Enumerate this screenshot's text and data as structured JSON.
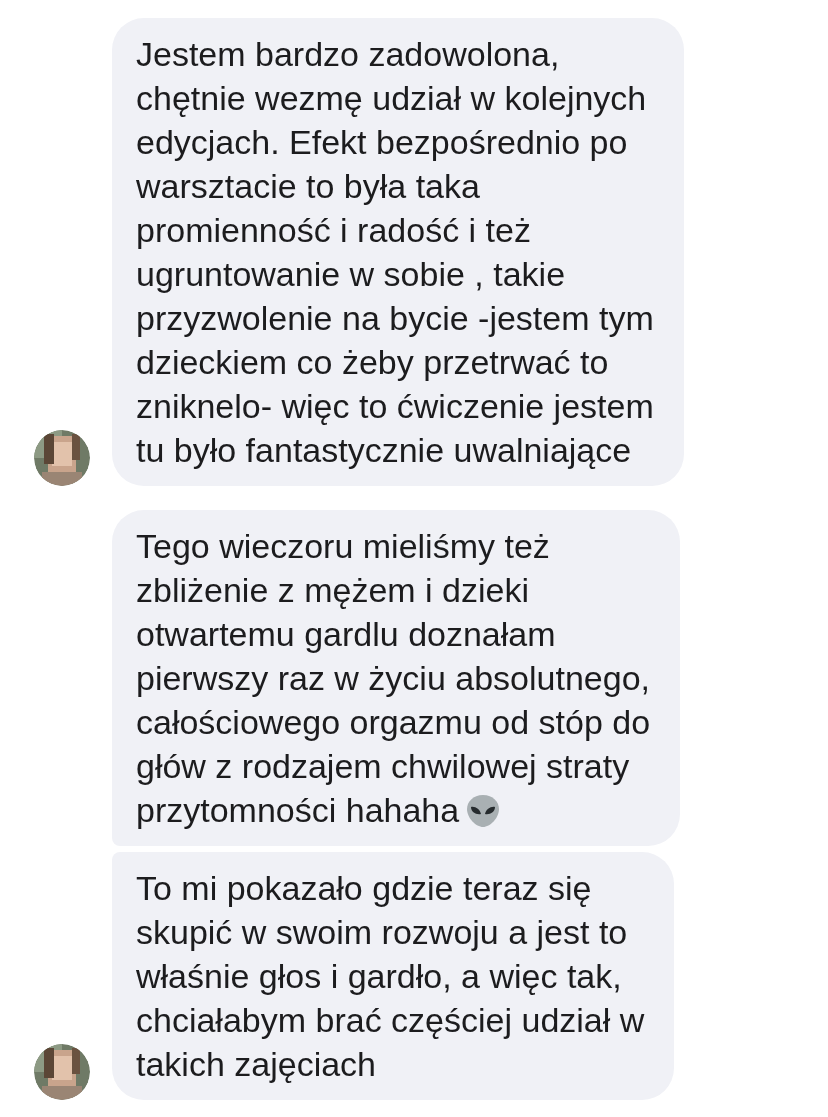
{
  "messages": [
    {
      "text": "Jestem bardzo zadowolona,\nchętnie wezmę udział w kolejnych\nedycjach. Efekt bezpośrednio po\nwarsztacie to była taka\npromienność i radość i też\nugruntowanie w sobie , takie\nprzyzwolenie na bycie -jestem tym\ndzieckiem co żeby przetrwać to\nzniknelo- więc to ćwiczenie jestem\ntu było fantastycznie uwalniające",
      "avatar": true,
      "alien_emoji": false
    },
    {
      "text": "Tego wieczoru mieliśmy też\nzbliżenie z mężem i dzieki\notwartemu gardlu doznałam\npierwszy raz w życiu absolutnego,\ncałościowego orgazmu od stóp do\ngłów z rodzajem chwilowej straty\nprzytomności hahaha",
      "avatar": false,
      "alien_emoji": true
    },
    {
      "text": "To mi pokazało gdzie teraz się\nskupić w swoim rozwoju a jest to\nwłaśnie głos i gardło, a więc tak,\nchciałabym brać częściej udział w\ntakich zajęciach",
      "avatar": true,
      "alien_emoji": false
    }
  ]
}
